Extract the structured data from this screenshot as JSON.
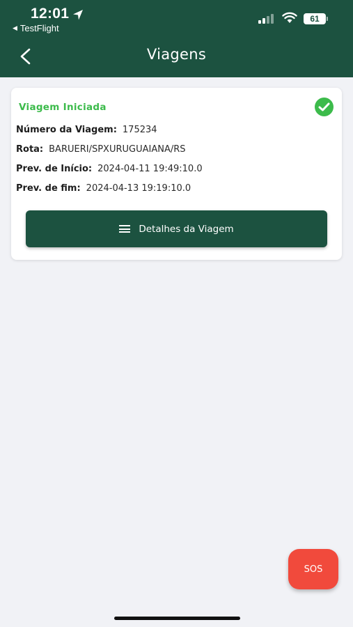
{
  "status_bar": {
    "time": "12:01",
    "back_app": "TestFlight",
    "battery": "61"
  },
  "header": {
    "title": "Viagens"
  },
  "trip_card": {
    "status": "Viagem Iniciada",
    "fields": [
      {
        "label": "Número da Viagem:",
        "value": "175234"
      },
      {
        "label": "Rota:",
        "value": "BARUERI/SPXURUGUAIANA/RS"
      },
      {
        "label": "Prev. de Início:",
        "value": "2024-04-11 19:49:10.0"
      },
      {
        "label": "Prev. de fim:",
        "value": "2024-04-13 19:19:10.0"
      }
    ],
    "details_button": "Detalhes da Viagem"
  },
  "sos_button": "SOS",
  "colors": {
    "primary": "#1c5240",
    "success": "#3cbb4b",
    "sos": "#f14a3c",
    "background": "#f1f2f6"
  }
}
